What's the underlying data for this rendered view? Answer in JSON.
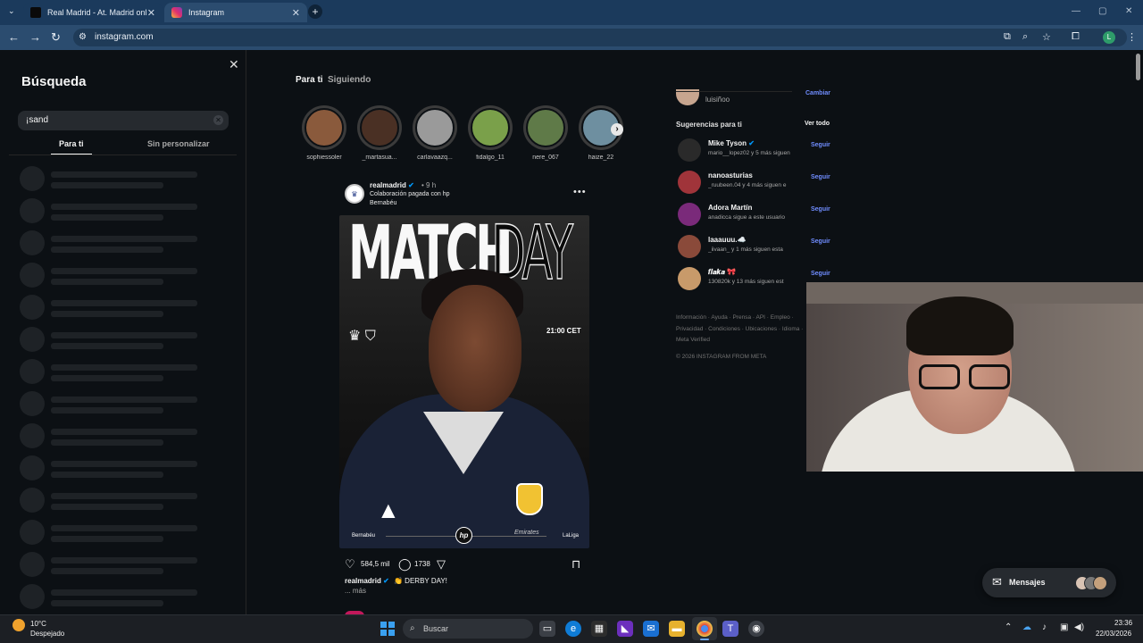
{
  "browser": {
    "tabs": [
      {
        "title": "Real Madrid - At. Madrid online",
        "active": false
      },
      {
        "title": "Instagram",
        "active": true
      }
    ],
    "new_tab": "+",
    "url": "instagram.com",
    "profile_initial": "L"
  },
  "search_panel": {
    "title": "Búsqueda",
    "query": "¡sand",
    "tabs": [
      "Para ti",
      "Sin personalizar"
    ],
    "skeleton_rows": 14
  },
  "feed": {
    "tabs": [
      "Para ti",
      "Siguiendo"
    ],
    "stories": [
      {
        "name": "sophiessoler",
        "color": "#8a5a3c"
      },
      {
        "name": "_martasua...",
        "color": "#4a3024"
      },
      {
        "name": "carlavaazq...",
        "color": "#9a9a9a"
      },
      {
        "name": "fidalgo_11",
        "color": "#7aa04a"
      },
      {
        "name": "nere_067",
        "color": "#5f7a48"
      },
      {
        "name": "haize_22",
        "color": "#6e8fa0"
      }
    ],
    "post": {
      "username": "realmadrid",
      "time": "• 9 h",
      "collab": "Colaboración pagada con hp",
      "location": "Bernabéu",
      "media": {
        "match": "MATCH",
        "day": "DAY",
        "kickoff": "21:00 CET",
        "left_tag": "Bernabéu",
        "right_tag": "LaLiga",
        "sponsor": "hp",
        "shirt_sponsor": "Emirates"
      },
      "likes": "584,5 mil",
      "comments": "1738",
      "caption_user": "realmadrid",
      "caption": "👏 DERBY DAY!",
      "more": "... más"
    }
  },
  "sidebar": {
    "me": {
      "name": "luisiñoo",
      "switch": "Cambiar"
    },
    "suggestions_title": "Sugerencias para ti",
    "see_all": "Ver todo",
    "suggestions": [
      {
        "name": "Mike Tyson",
        "sub": "mario__lopez02 y 5 más siguen",
        "follow": "Seguir",
        "color": "#2a2a2a"
      },
      {
        "name": "nanoasturias",
        "sub": "_ruubeen.04 y 4 más siguen e",
        "follow": "Seguir",
        "color": "#a0343a"
      },
      {
        "name": "Adora Martín",
        "sub": "anadicca sigue a este usuario",
        "follow": "Seguir",
        "color": "#7a2a7a"
      },
      {
        "name": "laaauuu.☁️",
        "sub": "_iivaan_ y 1 más siguen esta",
        "follow": "Seguir",
        "color": "#8a4a3a"
      },
      {
        "name": "𝒇𝒍𝒂𝒌𝒂 🎀",
        "sub": "130820k y 13 más siguen est",
        "follow": "Seguir",
        "color": "#c89a6a"
      }
    ],
    "footer_links": "Información · Ayuda · Prensa · API · Empleo · Privacidad · Condiciones · Ubicaciones · Idioma · Meta Verified",
    "copyright": "© 2026 INSTAGRAM FROM META"
  },
  "messages": {
    "label": "Mensajes"
  },
  "taskbar": {
    "weather_temp": "10°C",
    "weather_desc": "Despejado",
    "search_placeholder": "Buscar",
    "time": "23:36",
    "date": "22/03/2026"
  }
}
